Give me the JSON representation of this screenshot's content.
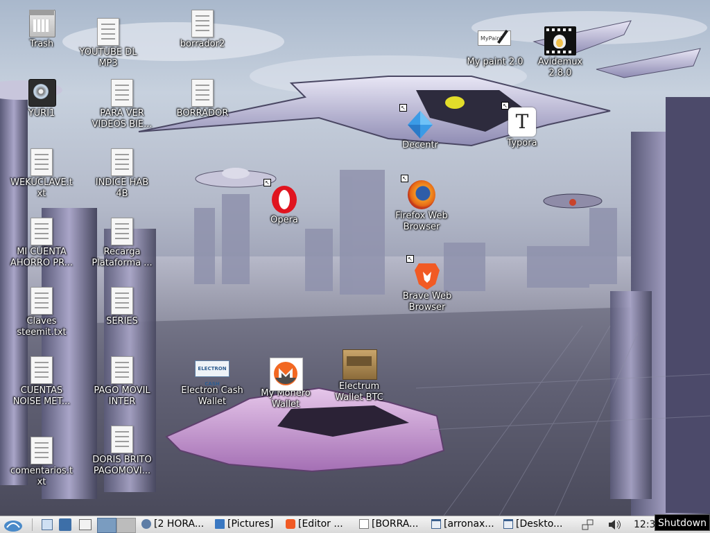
{
  "desktop": {
    "icons": [
      {
        "label": "Trash",
        "icon": "trash-icon"
      },
      {
        "label": "YOUTUBE DL MP3",
        "icon": "document-icon"
      },
      {
        "label": "borrador2",
        "icon": "document-icon"
      },
      {
        "label": "YURI1",
        "icon": "disc-icon"
      },
      {
        "label": "PARA VER VIDEOS BIE...",
        "icon": "document-icon"
      },
      {
        "label": "BORRADOR",
        "icon": "document-icon"
      },
      {
        "label": "WEKUCLAVE.txt",
        "icon": "document-icon"
      },
      {
        "label": "INDICE HAB 4B",
        "icon": "document-icon"
      },
      {
        "label": "MI CUENTA AHORRO PR...",
        "icon": "document-icon"
      },
      {
        "label": "Recarga Plataforma ...",
        "icon": "document-icon"
      },
      {
        "label": "Claves steemit.txt",
        "icon": "document-icon"
      },
      {
        "label": "SERIES",
        "icon": "document-icon"
      },
      {
        "label": "CUENTAS NOISE MET...",
        "icon": "document-icon"
      },
      {
        "label": "PAGO MOVIL INTER",
        "icon": "document-icon"
      },
      {
        "label": "comentarios.txt",
        "icon": "document-icon"
      },
      {
        "label": "DORIS BRITO PAGOMOVI...",
        "icon": "document-icon"
      },
      {
        "label": "My paint 2.0",
        "icon": "mypaint-icon"
      },
      {
        "label": "Avidemux 2.8.0",
        "icon": "avidemux-icon"
      },
      {
        "label": "Decentr",
        "icon": "decentr-icon"
      },
      {
        "label": "Typora",
        "icon": "typora-icon"
      },
      {
        "label": "Opera",
        "icon": "opera-icon"
      },
      {
        "label": "Firefox Web Browser",
        "icon": "firefox-icon"
      },
      {
        "label": "Brave Web Browser",
        "icon": "brave-icon"
      },
      {
        "label": "Electron Cash Wallet",
        "icon": "electron-cash-icon"
      },
      {
        "label": "My Monero Wallet",
        "icon": "monero-icon"
      },
      {
        "label": "Electrum Wallet BTC",
        "icon": "electrum-icon"
      }
    ],
    "mypaint_logo_text": "MyPaint",
    "electron_cash_logo_text": "ELECTRON CASH"
  },
  "taskbar": {
    "tasks": [
      {
        "label": "[2 HORA...",
        "icon": "people-icon"
      },
      {
        "label": "[Pictures]",
        "icon": "folder-icon"
      },
      {
        "label": "[Editor ...",
        "icon": "brave-icon"
      },
      {
        "label": "[BORRA...",
        "icon": "document-icon"
      },
      {
        "label": "[arronax...",
        "icon": "window-icon"
      },
      {
        "label": "[Deskto...",
        "icon": "window-icon"
      }
    ],
    "clock": "12:3",
    "tooltip": "Shutdown"
  },
  "colors": {
    "taskbar_bg": "#e6e6e6",
    "label_text": "#ffffff",
    "workspace_active": "#7a9cc0",
    "opera_red": "#e0141f",
    "firefox_orange": "#e66a16",
    "brave_orange": "#f15a24",
    "monero_orange": "#f26822"
  }
}
